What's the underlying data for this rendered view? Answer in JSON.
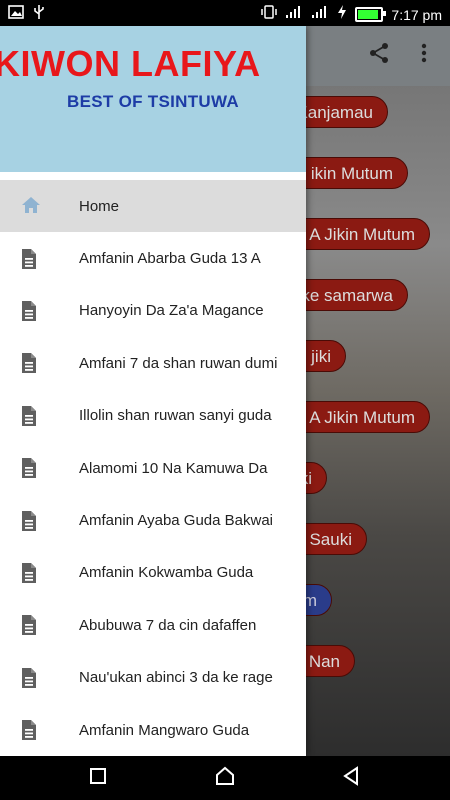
{
  "status_bar": {
    "time": "7:17 pm",
    "battery_level": 1.0,
    "battery_color": "#33ff33"
  },
  "drawer": {
    "header": {
      "title": "KIWON LAFIYA",
      "subtitle": "BEST OF TSINTUWA",
      "background": "#a7d2e3",
      "title_color": "#e8171b",
      "subtitle_color": "#1d3ca6"
    },
    "items": [
      {
        "label": "Home",
        "icon": "home-icon",
        "active": true
      },
      {
        "label": "Amfanin Abarba Guda 13 A",
        "icon": "document-icon"
      },
      {
        "label": "Hanyoyin Da Za'a Magance",
        "icon": "document-icon"
      },
      {
        "label": "Amfani 7 da shan ruwan dumi",
        "icon": "document-icon"
      },
      {
        "label": "Illolin shan ruwan sanyi guda",
        "icon": "document-icon"
      },
      {
        "label": "Alamomi 10 Na Kamuwa Da",
        "icon": "document-icon"
      },
      {
        "label": "Amfanin Ayaba Guda Bakwai",
        "icon": "document-icon"
      },
      {
        "label": "Amfanin Kokwamba Guda",
        "icon": "document-icon"
      },
      {
        "label": "Abubuwa 7 da cin dafaffen",
        "icon": "document-icon"
      },
      {
        "label": "Nau'ukan abinci 3 da ke rage",
        "icon": "document-icon"
      },
      {
        "label": "Amfanin Mangwaro Guda",
        "icon": "document-icon"
      }
    ]
  },
  "background_buttons": [
    {
      "label": "Kanjamau"
    },
    {
      "label": "ikin Mutum"
    },
    {
      "label": "A Jikin Mutum"
    },
    {
      "label": "ke samarwa"
    },
    {
      "label": "jiki"
    },
    {
      "label": "A Jikin Mutum"
    },
    {
      "label": "ki"
    },
    {
      "label": "Sauki"
    },
    {
      "label": "m"
    },
    {
      "label": "Nan"
    }
  ],
  "app_bar": {
    "share_icon": "share-icon",
    "more_icon": "more-vert-icon"
  },
  "nav_bar": {
    "recents": "recents-icon",
    "home": "home-nav-icon",
    "back": "back-icon"
  }
}
